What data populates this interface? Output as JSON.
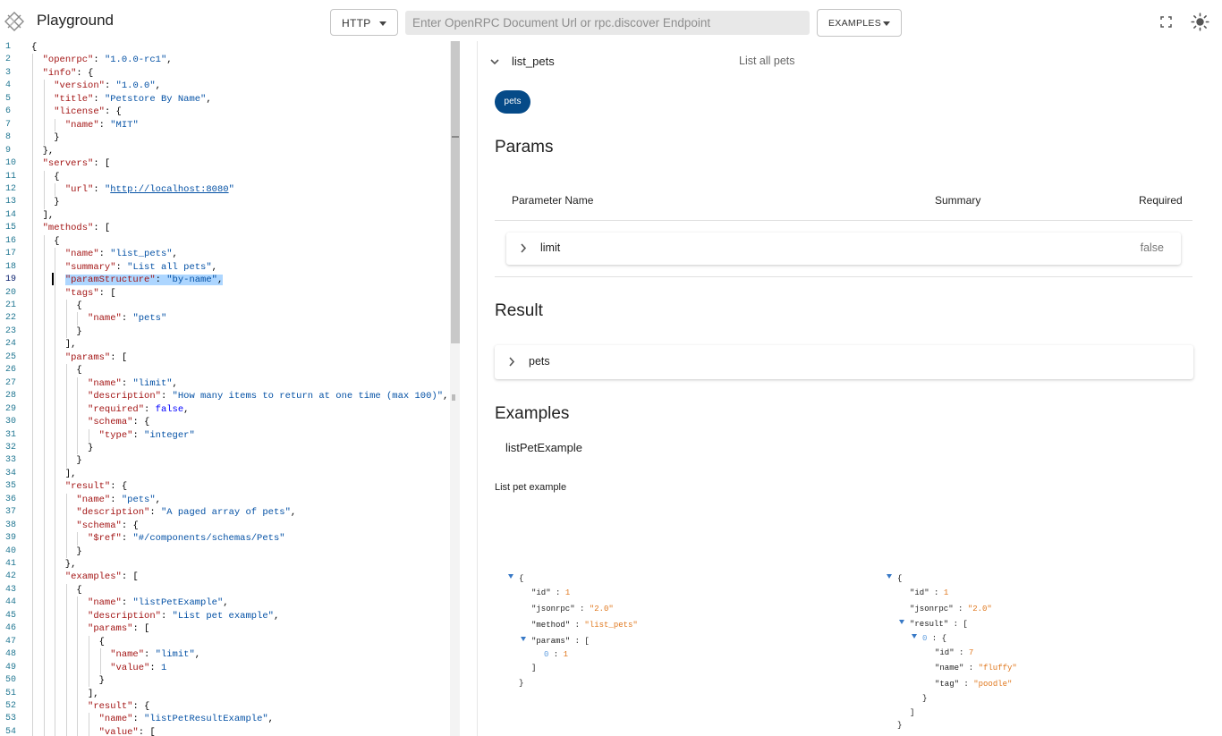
{
  "header": {
    "title": "Playground",
    "transport": "HTTP",
    "url_placeholder": "Enter OpenRPC Document Url or rpc.discover Endpoint",
    "url_value": "",
    "examples_label": "EXAMPLES"
  },
  "editor": {
    "lines": [
      [
        [
          "p",
          "{"
        ]
      ],
      [
        [
          "p",
          "  "
        ],
        [
          "k",
          "\"openrpc\""
        ],
        [
          "p",
          ": "
        ],
        [
          "s",
          "\"1.0.0-rc1\""
        ],
        [
          "p",
          ","
        ]
      ],
      [
        [
          "p",
          "  "
        ],
        [
          "k",
          "\"info\""
        ],
        [
          "p",
          ": {"
        ]
      ],
      [
        [
          "p",
          "    "
        ],
        [
          "k",
          "\"version\""
        ],
        [
          "p",
          ": "
        ],
        [
          "s",
          "\"1.0.0\""
        ],
        [
          "p",
          ","
        ]
      ],
      [
        [
          "p",
          "    "
        ],
        [
          "k",
          "\"title\""
        ],
        [
          "p",
          ": "
        ],
        [
          "s",
          "\"Petstore By Name\""
        ],
        [
          "p",
          ","
        ]
      ],
      [
        [
          "p",
          "    "
        ],
        [
          "k",
          "\"license\""
        ],
        [
          "p",
          ": {"
        ]
      ],
      [
        [
          "p",
          "      "
        ],
        [
          "k",
          "\"name\""
        ],
        [
          "p",
          ": "
        ],
        [
          "s",
          "\"MIT\""
        ]
      ],
      [
        [
          "p",
          "    }"
        ]
      ],
      [
        [
          "p",
          "  },"
        ]
      ],
      [
        [
          "p",
          "  "
        ],
        [
          "k",
          "\"servers\""
        ],
        [
          "p",
          ": ["
        ]
      ],
      [
        [
          "p",
          "    {"
        ]
      ],
      [
        [
          "p",
          "      "
        ],
        [
          "k",
          "\"url\""
        ],
        [
          "p",
          ": "
        ],
        [
          "s",
          "\""
        ],
        [
          "u",
          "http://localhost:8080"
        ],
        [
          "s",
          "\""
        ]
      ],
      [
        [
          "p",
          "    }"
        ]
      ],
      [
        [
          "p",
          "  ],"
        ]
      ],
      [
        [
          "p",
          "  "
        ],
        [
          "k",
          "\"methods\""
        ],
        [
          "p",
          ": ["
        ]
      ],
      [
        [
          "p",
          "    {"
        ]
      ],
      [
        [
          "p",
          "      "
        ],
        [
          "k",
          "\"name\""
        ],
        [
          "p",
          ": "
        ],
        [
          "s",
          "\"list_pets\""
        ],
        [
          "p",
          ","
        ]
      ],
      [
        [
          "p",
          "      "
        ],
        [
          "k",
          "\"summary\""
        ],
        [
          "p",
          ": "
        ],
        [
          "s",
          "\"List all pets\""
        ],
        [
          "p",
          ","
        ]
      ],
      [
        [
          "p",
          "      "
        ],
        [
          "hk",
          "\"paramStructure\""
        ],
        [
          "h",
          ": "
        ],
        [
          "hs",
          "\"by-name\""
        ],
        [
          "h",
          ","
        ]
      ],
      [
        [
          "p",
          "      "
        ],
        [
          "k",
          "\"tags\""
        ],
        [
          "p",
          ": ["
        ]
      ],
      [
        [
          "p",
          "        {"
        ]
      ],
      [
        [
          "p",
          "          "
        ],
        [
          "k",
          "\"name\""
        ],
        [
          "p",
          ": "
        ],
        [
          "s",
          "\"pets\""
        ]
      ],
      [
        [
          "p",
          "        }"
        ]
      ],
      [
        [
          "p",
          "      ],"
        ]
      ],
      [
        [
          "p",
          "      "
        ],
        [
          "k",
          "\"params\""
        ],
        [
          "p",
          ": ["
        ]
      ],
      [
        [
          "p",
          "        {"
        ]
      ],
      [
        [
          "p",
          "          "
        ],
        [
          "k",
          "\"name\""
        ],
        [
          "p",
          ": "
        ],
        [
          "s",
          "\"limit\""
        ],
        [
          "p",
          ","
        ]
      ],
      [
        [
          "p",
          "          "
        ],
        [
          "k",
          "\"description\""
        ],
        [
          "p",
          ": "
        ],
        [
          "s",
          "\"How many items to return at one time (max 100)\""
        ],
        [
          "p",
          ","
        ]
      ],
      [
        [
          "p",
          "          "
        ],
        [
          "k",
          "\"required\""
        ],
        [
          "p",
          ": "
        ],
        [
          "kw",
          "false"
        ],
        [
          "p",
          ","
        ]
      ],
      [
        [
          "p",
          "          "
        ],
        [
          "k",
          "\"schema\""
        ],
        [
          "p",
          ": {"
        ]
      ],
      [
        [
          "p",
          "            "
        ],
        [
          "k",
          "\"type\""
        ],
        [
          "p",
          ": "
        ],
        [
          "s",
          "\"integer\""
        ]
      ],
      [
        [
          "p",
          "          }"
        ]
      ],
      [
        [
          "p",
          "        }"
        ]
      ],
      [
        [
          "p",
          "      ],"
        ]
      ],
      [
        [
          "p",
          "      "
        ],
        [
          "k",
          "\"result\""
        ],
        [
          "p",
          ": {"
        ]
      ],
      [
        [
          "p",
          "        "
        ],
        [
          "k",
          "\"name\""
        ],
        [
          "p",
          ": "
        ],
        [
          "s",
          "\"pets\""
        ],
        [
          "p",
          ","
        ]
      ],
      [
        [
          "p",
          "        "
        ],
        [
          "k",
          "\"description\""
        ],
        [
          "p",
          ": "
        ],
        [
          "s",
          "\"A paged array of pets\""
        ],
        [
          "p",
          ","
        ]
      ],
      [
        [
          "p",
          "        "
        ],
        [
          "k",
          "\"schema\""
        ],
        [
          "p",
          ": {"
        ]
      ],
      [
        [
          "p",
          "          "
        ],
        [
          "k",
          "\"$ref\""
        ],
        [
          "p",
          ": "
        ],
        [
          "s",
          "\"#/components/schemas/Pets\""
        ]
      ],
      [
        [
          "p",
          "        }"
        ]
      ],
      [
        [
          "p",
          "      },"
        ]
      ],
      [
        [
          "p",
          "      "
        ],
        [
          "k",
          "\"examples\""
        ],
        [
          "p",
          ": ["
        ]
      ],
      [
        [
          "p",
          "        {"
        ]
      ],
      [
        [
          "p",
          "          "
        ],
        [
          "k",
          "\"name\""
        ],
        [
          "p",
          ": "
        ],
        [
          "s",
          "\"listPetExample\""
        ],
        [
          "p",
          ","
        ]
      ],
      [
        [
          "p",
          "          "
        ],
        [
          "k",
          "\"description\""
        ],
        [
          "p",
          ": "
        ],
        [
          "s",
          "\"List pet example\""
        ],
        [
          "p",
          ","
        ]
      ],
      [
        [
          "p",
          "          "
        ],
        [
          "k",
          "\"params\""
        ],
        [
          "p",
          ": ["
        ]
      ],
      [
        [
          "p",
          "            {"
        ]
      ],
      [
        [
          "p",
          "              "
        ],
        [
          "k",
          "\"name\""
        ],
        [
          "p",
          ": "
        ],
        [
          "s",
          "\"limit\""
        ],
        [
          "p",
          ","
        ]
      ],
      [
        [
          "p",
          "              "
        ],
        [
          "k",
          "\"value\""
        ],
        [
          "p",
          ": "
        ],
        [
          "s",
          "1"
        ]
      ],
      [
        [
          "p",
          "            }"
        ]
      ],
      [
        [
          "p",
          "          ],"
        ]
      ],
      [
        [
          "p",
          "          "
        ],
        [
          "k",
          "\"result\""
        ],
        [
          "p",
          ": {"
        ]
      ],
      [
        [
          "p",
          "            "
        ],
        [
          "k",
          "\"name\""
        ],
        [
          "p",
          ": "
        ],
        [
          "s",
          "\"listPetResultExample\""
        ],
        [
          "p",
          ","
        ]
      ],
      [
        [
          "p",
          "            "
        ],
        [
          "k",
          "\"value\""
        ],
        [
          "p",
          ": ["
        ]
      ]
    ],
    "active_line": 19
  },
  "method": {
    "name": "list_pets",
    "summary": "List all pets",
    "tag": "pets",
    "params_heading": "Params",
    "params_columns": {
      "name": "Parameter Name",
      "summary": "Summary",
      "required": "Required"
    },
    "param": {
      "name": "limit",
      "required": "false"
    },
    "result_heading": "Result",
    "result_name": "pets",
    "examples_heading": "Examples",
    "example_tab": "listPetExample",
    "example_description": "List pet example"
  },
  "request_json": [
    [
      [
        "t",
        ""
      ],
      [
        "p",
        "{"
      ]
    ],
    [
      [
        "k",
        "\"id\""
      ],
      [
        "p",
        " : "
      ],
      [
        "v",
        "1"
      ]
    ],
    [
      [
        "k",
        "\"jsonrpc\""
      ],
      [
        "p",
        " : "
      ],
      [
        "v",
        "\"2.0\""
      ]
    ],
    [
      [
        "k",
        "\"method\""
      ],
      [
        "p",
        " : "
      ],
      [
        "v",
        "\"list_pets\""
      ]
    ],
    [
      [
        "t",
        ""
      ],
      [
        "k",
        "\"params\""
      ],
      [
        "p",
        " : ["
      ]
    ],
    [
      [
        "i",
        "0"
      ],
      [
        "p",
        " : "
      ],
      [
        "v",
        "1"
      ]
    ],
    [
      [
        "p",
        "]"
      ]
    ],
    [
      [
        "p",
        "}"
      ]
    ]
  ],
  "response_json": [
    [
      [
        "t",
        ""
      ],
      [
        "p",
        "{"
      ]
    ],
    [
      [
        "k",
        "\"id\""
      ],
      [
        "p",
        " : "
      ],
      [
        "v",
        "1"
      ]
    ],
    [
      [
        "k",
        "\"jsonrpc\""
      ],
      [
        "p",
        " : "
      ],
      [
        "v",
        "\"2.0\""
      ]
    ],
    [
      [
        "t",
        ""
      ],
      [
        "k",
        "\"result\""
      ],
      [
        "p",
        " : ["
      ]
    ],
    [
      [
        "t",
        ""
      ],
      [
        "i",
        "0"
      ],
      [
        "p",
        " : {"
      ]
    ],
    [
      [
        "k",
        "\"id\""
      ],
      [
        "p",
        " : "
      ],
      [
        "v",
        "7"
      ]
    ],
    [
      [
        "k",
        "\"name\""
      ],
      [
        "p",
        " : "
      ],
      [
        "v",
        "\"fluffy\""
      ]
    ],
    [
      [
        "k",
        "\"tag\""
      ],
      [
        "p",
        " : "
      ],
      [
        "v",
        "\"poodle\""
      ]
    ],
    [
      [
        "p",
        "}"
      ]
    ],
    [
      [
        "p",
        "]"
      ]
    ],
    [
      [
        "p",
        "}"
      ]
    ]
  ]
}
